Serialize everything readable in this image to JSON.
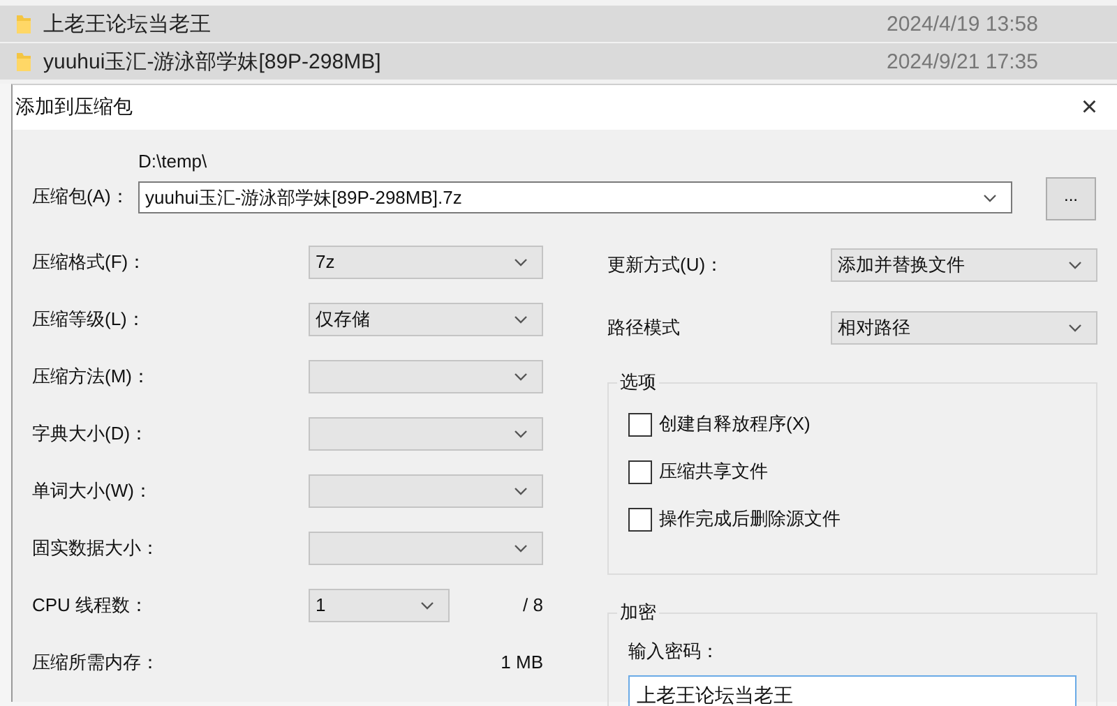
{
  "file_list": [
    {
      "name": "上老王论坛当老王",
      "date": "2024/4/19 13:58",
      "selected": true
    },
    {
      "name": "yuuhui玉汇-游泳部学妹[89P-298MB]",
      "date": "2024/9/21 17:35",
      "selected": true
    }
  ],
  "dialog": {
    "title": "添加到压缩包",
    "close": "×",
    "archive": {
      "label": "压缩包(A)：",
      "folder": "D:\\temp\\",
      "value": "yuuhui玉汇-游泳部学妹[89P-298MB].7z",
      "browse": "..."
    },
    "left_settings": [
      {
        "kind": "combo",
        "label": "压缩格式(F)：",
        "value": "7z"
      },
      {
        "kind": "combo",
        "label": "压缩等级(L)：",
        "value": "仅存储"
      },
      {
        "kind": "combo",
        "label": "压缩方法(M)："
      },
      {
        "kind": "combo",
        "label": "字典大小(D)："
      },
      {
        "kind": "combo",
        "label": "单词大小(W)："
      },
      {
        "kind": "combo",
        "label": "固实数据大小："
      },
      {
        "kind": "threads",
        "label": "CPU 线程数：",
        "value": "1",
        "suffix": "/ 8"
      },
      {
        "kind": "readout",
        "label": "压缩所需内存：",
        "suffix": "1 MB"
      }
    ],
    "right_settings": [
      {
        "label": "更新方式(U)：",
        "value": "添加并替换文件"
      },
      {
        "label": "路径模式",
        "value": "相对路径"
      }
    ],
    "options": {
      "title": "选项",
      "items": [
        {
          "label": "创建自释放程序(X)",
          "checked": false
        },
        {
          "label": "压缩共享文件",
          "checked": false
        },
        {
          "label": "操作完成后删除源文件",
          "checked": false
        }
      ]
    },
    "encryption": {
      "title": "加密",
      "password_label": "输入密码：",
      "password": "上老王论坛当老王"
    }
  }
}
